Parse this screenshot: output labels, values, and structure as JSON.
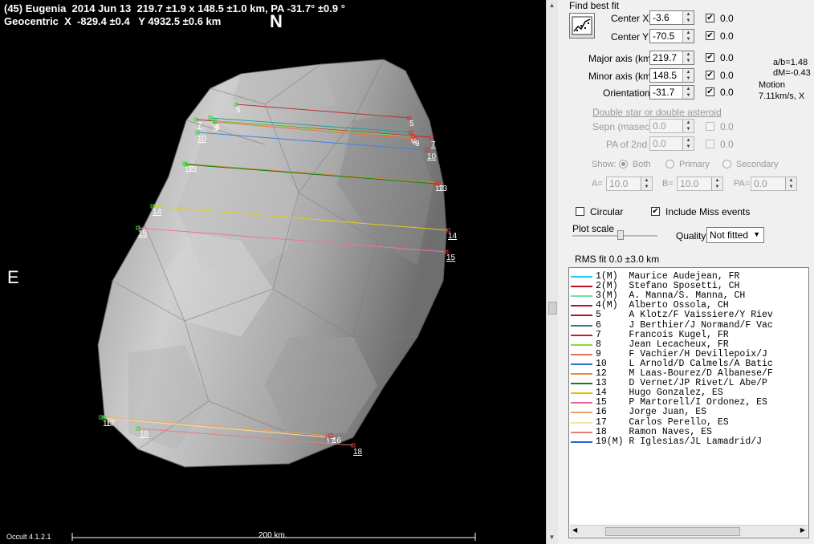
{
  "plot": {
    "header_line1": "(45) Eugenia  2014 Jun 13  219.7 ±1.9 x 148.5 ±1.0 km, PA -31.7° ±0.9 °",
    "header_line2": "Geocentric  X  -829.4 ±0.4   Y 4932.5 ±0.6 km",
    "north_label": "N",
    "east_label": "E",
    "version": "Occult 4.1.2.1",
    "scale_label": "200 km.",
    "chords": [
      {
        "id": "5",
        "color": "#c03030"
      },
      {
        "id": "6",
        "color": "#20a0a0"
      },
      {
        "id": "7",
        "color": "#c02020"
      },
      {
        "id": "8",
        "color": "#70e040"
      },
      {
        "id": "9",
        "color": "#f07050"
      },
      {
        "id": "10",
        "color": "#4080e0"
      },
      {
        "id": "12",
        "color": "#d08a30"
      },
      {
        "id": "13",
        "color": "#108010"
      },
      {
        "id": "14",
        "color": "#e0d010"
      },
      {
        "id": "15",
        "color": "#f070b0"
      },
      {
        "id": "16",
        "color": "#f0a060"
      },
      {
        "id": "17",
        "color": "#f8e0a0"
      },
      {
        "id": "18",
        "color": "#e08080"
      }
    ]
  },
  "panel": {
    "title": "Find best fit",
    "center_x": {
      "label": "Center X",
      "value": "-3.6",
      "check": "0.0"
    },
    "center_y": {
      "label": "Center Y",
      "value": "-70.5",
      "check": "0.0"
    },
    "major": {
      "label": "Major axis (km)",
      "value": "219.7",
      "check": "0.0"
    },
    "minor": {
      "label": "Minor axis (km)",
      "value": "148.5",
      "check": "0.0"
    },
    "orientation": {
      "label": "Orientation",
      "value": "-31.7",
      "check": "0.0"
    },
    "ab": "a/b=1.48",
    "dm": "dM=-0.43",
    "motion": "Motion",
    "motion_val": "7.11km/s, X",
    "double_star_link": "Double star  or  double asteroid",
    "sepn": {
      "label": "Sepn (masec)",
      "value": "0.0",
      "check": "0.0"
    },
    "pa2": {
      "label": "PA of 2nd",
      "value": "0.0",
      "check": "0.0"
    },
    "show_label": "Show:",
    "show_both": "Both",
    "show_primary": "Primary",
    "show_secondary": "Secondary",
    "a_label": "A=",
    "a_val": "10.0",
    "b_label": "B=",
    "b_val": "10.0",
    "pa_label": "PA=",
    "pa_val": "0.0",
    "circular": "Circular",
    "include_miss": "Include Miss events",
    "plot_scale": "Plot scale",
    "quality_label": "Quality",
    "quality_value": "Not fitted",
    "rms": "RMS fit  0.0 ±3.0 km",
    "observers": [
      {
        "text": "1(M)  Maurice Audejean, FR",
        "color": "#20d0f0"
      },
      {
        "text": "2(M)  Stefano Sposetti, CH",
        "color": "#c01020"
      },
      {
        "text": "3(M)  A. Manna/S. Manna, CH",
        "color": "#70e0a0"
      },
      {
        "text": "4(M)  Alberto Ossola, CH",
        "color": "#b01830"
      },
      {
        "text": "5     A Klotz/F Vaissiere/Y Riev",
        "color": "#a02020"
      },
      {
        "text": "6     J Berthier/J Normand/F Vac",
        "color": "#308080"
      },
      {
        "text": "7     Francois Kugel, FR",
        "color": "#c02030"
      },
      {
        "text": "8     Jean Lecacheux, FR",
        "color": "#80e030"
      },
      {
        "text": "9     F Vachier/H Devillepoix/J",
        "color": "#e07060"
      },
      {
        "text": "10    L Arnold/D Calmels/A Batic",
        "color": "#3070d0"
      },
      {
        "text": "12    M Laas-Bourez/D Albanese/F",
        "color": "#e09040"
      },
      {
        "text": "13    D Vernet/JP Rivet/L Abe/P",
        "color": "#108020"
      },
      {
        "text": "14    Hugo Gonzalez, ES",
        "color": "#e0c000"
      },
      {
        "text": "15    P Martorell/I Ordonez, ES",
        "color": "#f060a0"
      },
      {
        "text": "16    Jorge Juan, ES",
        "color": "#f0a060"
      },
      {
        "text": "17    Carlos Perello, ES",
        "color": "#f8e0a0"
      },
      {
        "text": "18    Ramon Naves, ES",
        "color": "#e08080"
      },
      {
        "text": "19(M) R Iglesias/JL Lamadrid/J",
        "color": "#3060d0"
      }
    ]
  }
}
